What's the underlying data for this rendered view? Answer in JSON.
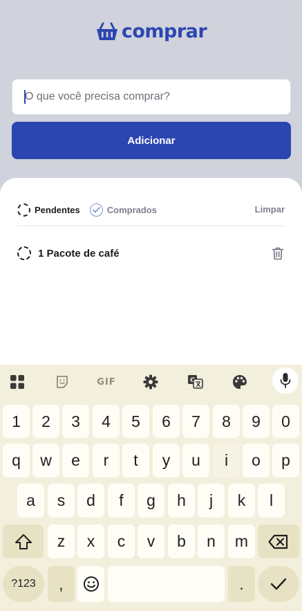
{
  "app": {
    "logo_text": "comprar",
    "brand_color": "#2c46b1"
  },
  "form": {
    "input_placeholder": "O que você precisa comprar?",
    "add_button_label": "Adicionar"
  },
  "list": {
    "tabs": [
      {
        "label": "Pendentes",
        "icon": "dashed-circle-icon",
        "active": true
      },
      {
        "label": "Comprados",
        "icon": "check-circle-icon",
        "active": false
      }
    ],
    "clear_label": "Limpar",
    "items": [
      {
        "label": "1 Pacote de café",
        "status": "pending",
        "icon": "trash-icon"
      }
    ]
  },
  "keyboard": {
    "toolbar_icons": [
      "apps-grid-icon",
      "sticker-icon",
      "gif-icon",
      "settings-gear-icon",
      "translate-icon",
      "palette-icon",
      "mic-icon"
    ],
    "gif_label": "GIF",
    "row_numbers": [
      "1",
      "2",
      "3",
      "4",
      "5",
      "6",
      "7",
      "8",
      "9",
      "0"
    ],
    "row_1": [
      "q",
      "w",
      "e",
      "r",
      "t",
      "y",
      "u",
      "i",
      "o",
      "p"
    ],
    "row_2": [
      "a",
      "s",
      "d",
      "f",
      "g",
      "h",
      "j",
      "k",
      "l"
    ],
    "row_3": [
      "z",
      "x",
      "c",
      "v",
      "b",
      "n",
      "m"
    ],
    "symbols_label": "?123",
    "comma_label": ",",
    "period_label": ".",
    "shift_icon": "shift-icon",
    "backspace_icon": "backspace-icon",
    "emoji_icon": "emoji-icon",
    "enter_icon": "checkmark-icon"
  }
}
